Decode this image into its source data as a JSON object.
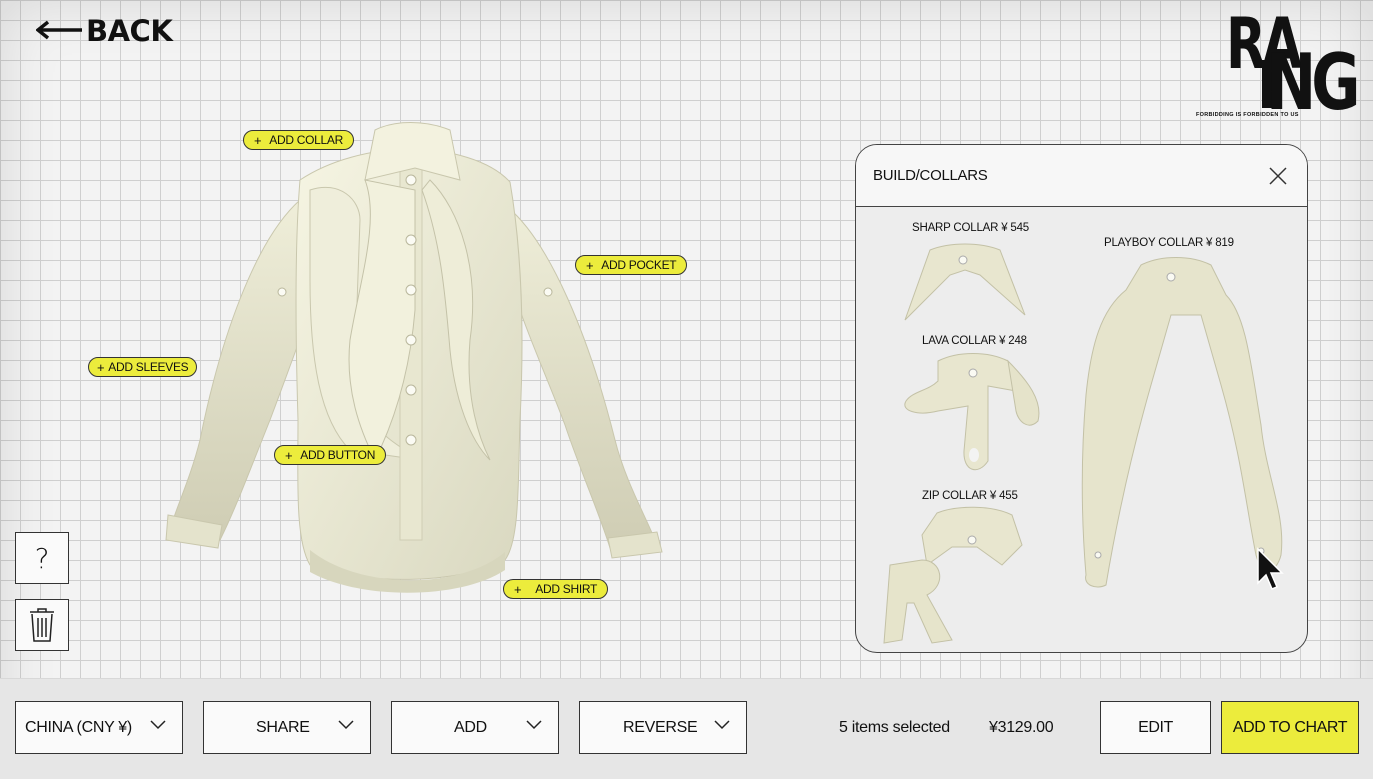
{
  "nav": {
    "back_label": "BACK"
  },
  "brand": {
    "line1": "RA",
    "line2": "NG",
    "tagline": "FORBIDDING IS FORBIDDEN TO US"
  },
  "hotspots": {
    "collar": "ADD COLLAR",
    "pocket": "ADD POCKET",
    "sleeves": "ADD SLEEVES",
    "button": "ADD BUTTON",
    "shirt": "ADD SHIRT"
  },
  "tools": {
    "help_symbol": "?"
  },
  "panel": {
    "title": "BUILD/COLLARS",
    "items": [
      {
        "name": "SHARP COLLAR",
        "price": "¥ 545",
        "label": "SHARP COLLAR ¥ 545"
      },
      {
        "name": "LAVA COLLAR",
        "price": "¥ 248",
        "label": "LAVA COLLAR ¥ 248"
      },
      {
        "name": "ZIP COLLAR",
        "price": "¥ 455",
        "label": "ZIP COLLAR ¥ 455"
      },
      {
        "name": "PLAYBOY COLLAR",
        "price": "¥ 819",
        "label": "PLAYBOY COLLAR ¥ 819"
      }
    ]
  },
  "toolbar": {
    "region": "CHINA (CNY ¥)",
    "share": "SHARE",
    "add": "ADD",
    "reverse": "REVERSE",
    "selection": "5 items selected",
    "total": "¥3129.00",
    "edit": "EDIT",
    "add_to_cart": "ADD TO CHART"
  },
  "colors": {
    "accent": "#ecec3c",
    "garment": "#ecebd6",
    "grid": "#cfcfcf"
  },
  "icons": [
    "arrow-left-icon",
    "plus-icon",
    "question-icon",
    "trash-icon",
    "close-icon",
    "chevron-down-icon",
    "cursor-icon"
  ]
}
